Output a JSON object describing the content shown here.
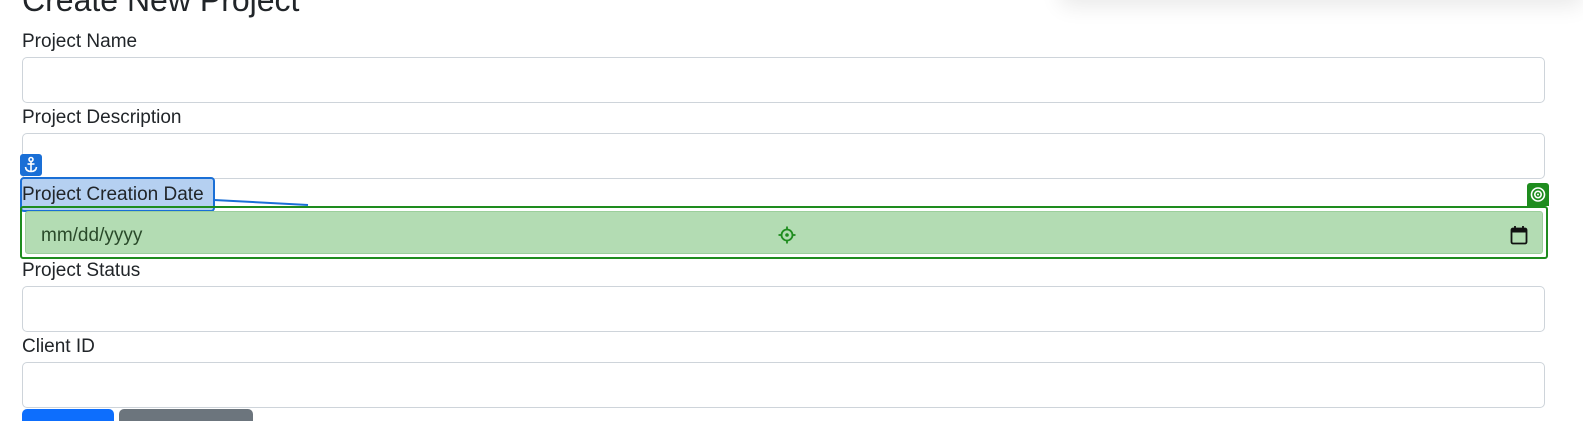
{
  "page": {
    "title": "Create New Project"
  },
  "form": {
    "fields": [
      {
        "label": "Project Name",
        "value": ""
      },
      {
        "label": "Project Description",
        "value": ""
      },
      {
        "label": "Project Creation Date",
        "value": "",
        "placeholder": "mm/dd/yyyy"
      },
      {
        "label": "Project Status",
        "value": ""
      },
      {
        "label": "Client ID",
        "value": ""
      }
    ]
  },
  "colors": {
    "label_highlight": "#1a6fd6",
    "target_highlight": "#1e8c1e",
    "target_fill": "#b3dcb3",
    "primary_button": "#0d6efd",
    "secondary_button": "#6c757d"
  },
  "icons": {
    "anchor": "anchor-icon",
    "target": "target-icon",
    "crosshair": "crosshair-icon",
    "calendar": "calendar-icon"
  }
}
